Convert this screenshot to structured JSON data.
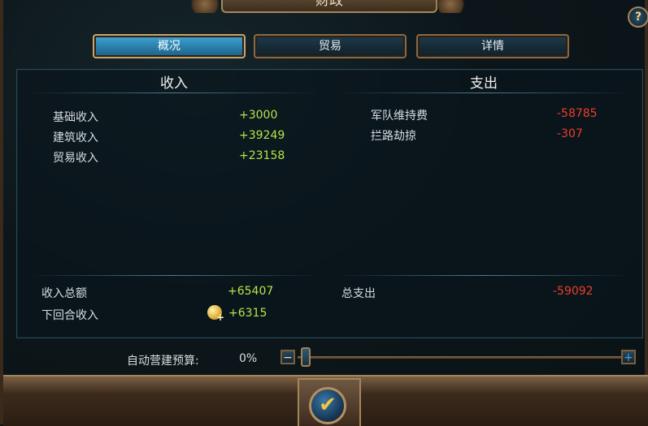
{
  "window": {
    "title": "财政"
  },
  "help": {
    "label": "?"
  },
  "tabs": [
    {
      "label": "概况"
    },
    {
      "label": "贸易"
    },
    {
      "label": "详情"
    }
  ],
  "income": {
    "heading": "收入",
    "rows": [
      {
        "label": "基础收入",
        "value": "+3000"
      },
      {
        "label": "建筑收入",
        "value": "+39249"
      },
      {
        "label": "贸易收入",
        "value": "+23158"
      }
    ],
    "total_label": "收入总额",
    "total_value": "+65407",
    "next_turn_label": "下回合收入",
    "next_turn_value": "+6315"
  },
  "expense": {
    "heading": "支出",
    "rows": [
      {
        "label": "军队维持费",
        "value": "-58785"
      },
      {
        "label": "拦路劫掠",
        "value": "-307"
      }
    ],
    "total_label": "总支出",
    "total_value": "-59092"
  },
  "budget": {
    "label": "自动营建预算:",
    "percent_text": "0%",
    "minus_label": "−",
    "plus_label": "+",
    "level": 0
  },
  "confirm": {
    "icon": "checkmark-icon",
    "glyph": "✔"
  },
  "colors": {
    "positive": "#b6e34a",
    "negative": "#ef3c2c",
    "accent_tab": "#3fa4d4",
    "frame": "#a5865a"
  }
}
